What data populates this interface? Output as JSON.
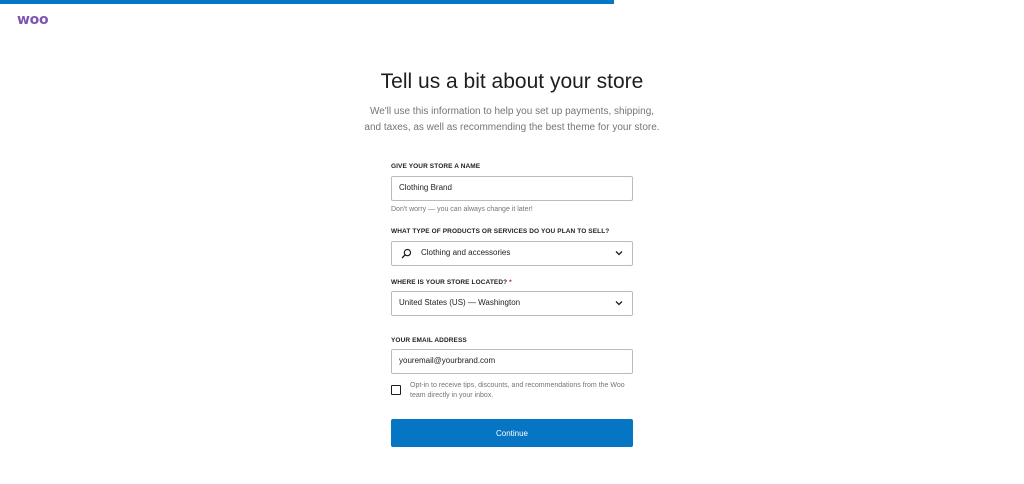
{
  "progress": {
    "percent": 60
  },
  "brand": {
    "logo_text": "woo",
    "color": "#7f54b3"
  },
  "accent_color": "#0675c4",
  "page": {
    "title": "Tell us a bit about your store",
    "subtitle": "We'll use this information to help you set up payments, shipping, and taxes, as well as recommending the best theme for your store."
  },
  "form": {
    "store_name": {
      "label": "GIVE YOUR STORE A NAME",
      "value": "Clothing Brand",
      "help": "Don't worry — you can always change it later!"
    },
    "products": {
      "label": "WHAT TYPE OF PRODUCTS OR SERVICES DO YOU PLAN TO SELL?",
      "value": "Clothing and accessories",
      "icon": "search-icon"
    },
    "location": {
      "label": "WHERE IS YOUR STORE LOCATED?",
      "required_marker": "*",
      "value": "United States (US) — Washington"
    },
    "email": {
      "label": "YOUR EMAIL ADDRESS",
      "value": "youremail@yourbrand.com"
    },
    "optin": {
      "checked": false,
      "text": "Opt-in to receive tips, discounts, and recommendations from the Woo team directly in your inbox."
    },
    "submit_label": "Continue"
  }
}
